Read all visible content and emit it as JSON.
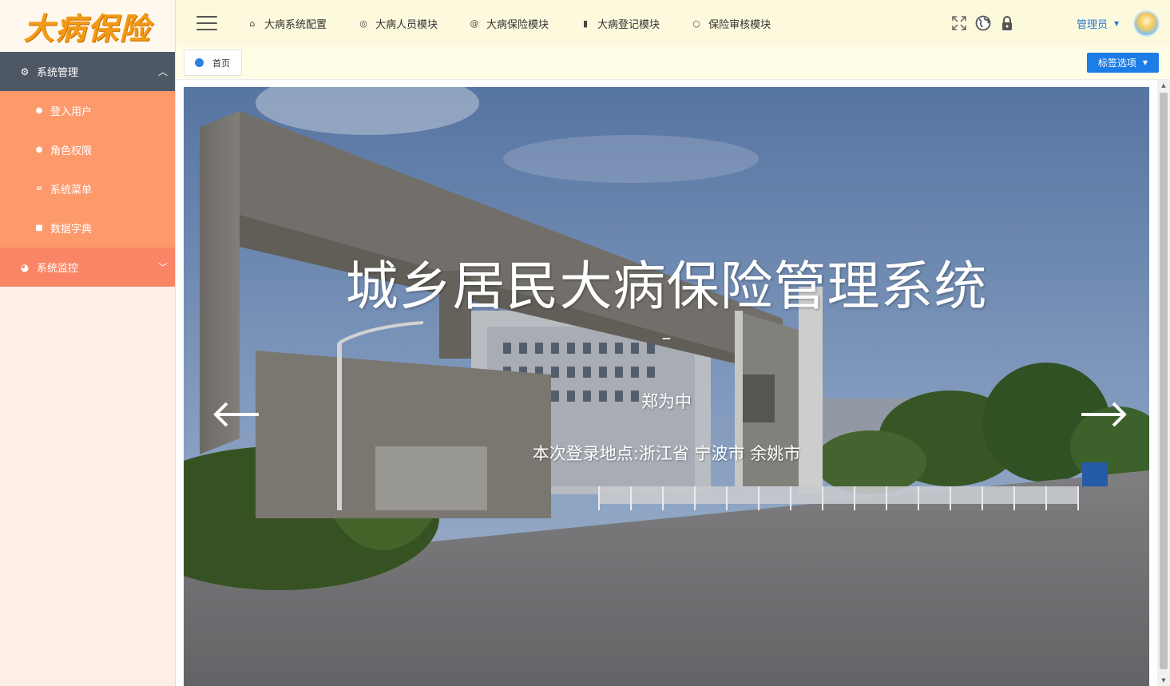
{
  "logo": {
    "text": "大病保险",
    "icon": "brand-logo"
  },
  "sidebar": {
    "groups": [
      {
        "label": "系统管理",
        "icon": "gear-icon",
        "expanded": true,
        "items": [
          {
            "label": "登入用户",
            "icon": "user-icon"
          },
          {
            "label": "角色权限",
            "icon": "users-icon"
          },
          {
            "label": "系统菜单",
            "icon": "list-icon"
          },
          {
            "label": "数据字典",
            "icon": "book-icon"
          }
        ]
      },
      {
        "label": "系统监控",
        "icon": "pie-chart-icon",
        "expanded": false
      }
    ]
  },
  "topnav": {
    "items": [
      {
        "label": "大病系统配置",
        "icon": "home-icon"
      },
      {
        "label": "大病人员模块",
        "icon": "dashboard-icon"
      },
      {
        "label": "大病保险模块",
        "icon": "at-icon"
      },
      {
        "label": "大病登记模块",
        "icon": "book-icon"
      },
      {
        "label": "保险审核模块",
        "icon": "circle-icon"
      }
    ],
    "icons": [
      "fullscreen-icon",
      "globe-icon",
      "lock-icon"
    ],
    "user": {
      "name": "管理员"
    }
  },
  "tabs": {
    "items": [
      {
        "label": "首页"
      }
    ],
    "options_label": "标签选项"
  },
  "banner": {
    "title": "城乡居民大病保险管理系统",
    "dash": "–",
    "name": "郑为中",
    "location": "本次登录地点:浙江省 宁波市 余姚市"
  },
  "colors": {
    "sidebar_bg": "#fdeee6",
    "active_group": "#4d5864",
    "submenu_bg": "#fc9a6c",
    "monitor_group": "#fa8566",
    "topbar_bg": "#fdf9dd",
    "accent_blue": "#1d7de6",
    "logo_orange": "#f39a16"
  }
}
